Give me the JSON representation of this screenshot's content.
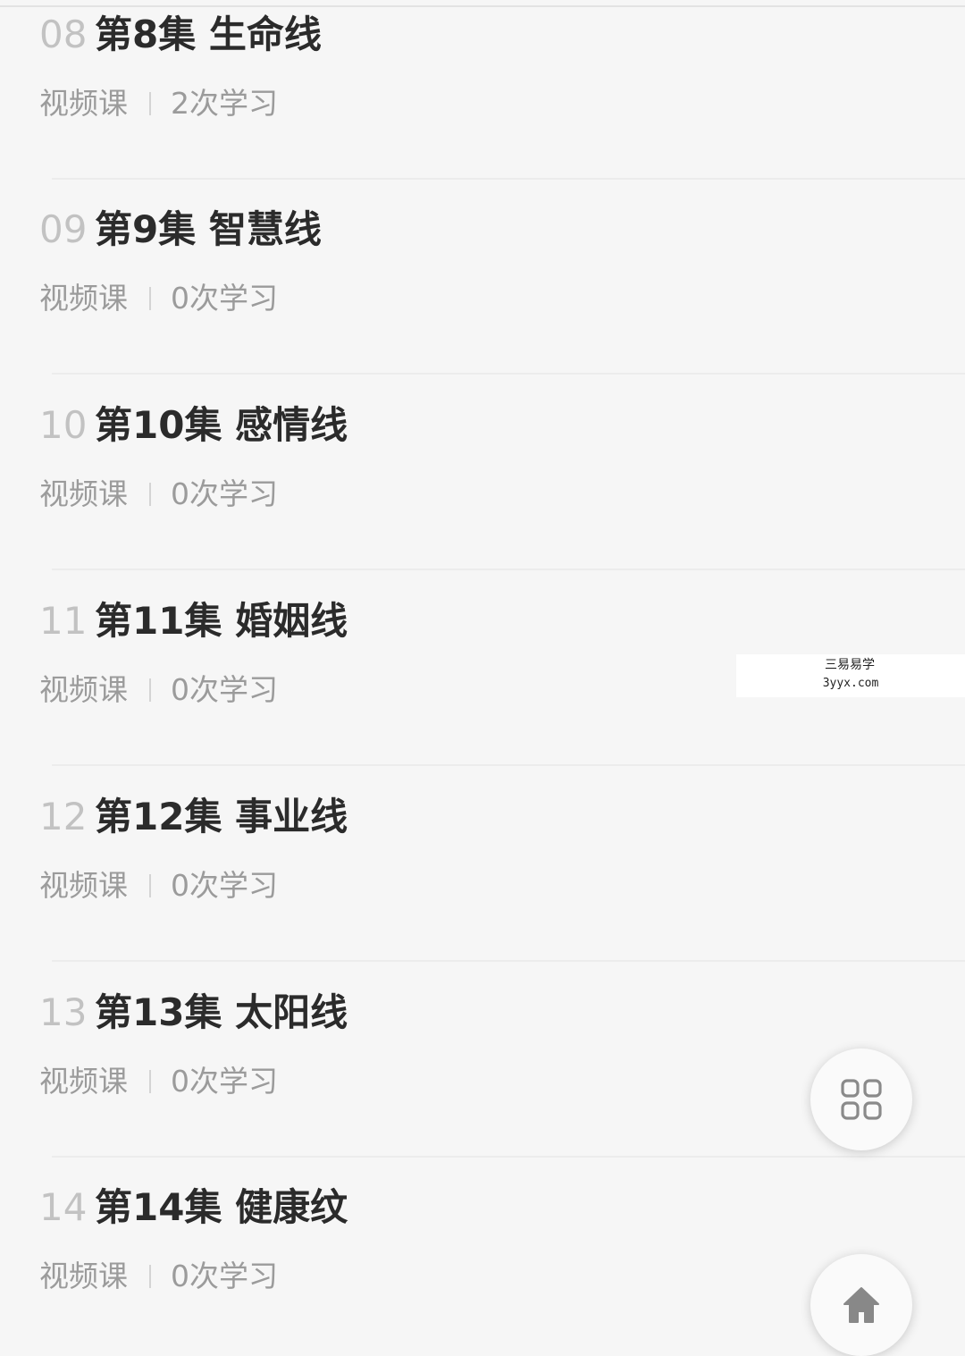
{
  "lessons": [
    {
      "num": "08",
      "title": "第8集 生命线",
      "type": "视频课",
      "study_count": "2次学习"
    },
    {
      "num": "09",
      "title": "第9集 智慧线",
      "type": "视频课",
      "study_count": "0次学习"
    },
    {
      "num": "10",
      "title": "第10集 感情线",
      "type": "视频课",
      "study_count": "0次学习"
    },
    {
      "num": "11",
      "title": "第11集 婚姻线",
      "type": "视频课",
      "study_count": "0次学习"
    },
    {
      "num": "12",
      "title": "第12集 事业线",
      "type": "视频课",
      "study_count": "0次学习"
    },
    {
      "num": "13",
      "title": "第13集 太阳线",
      "type": "视频课",
      "study_count": "0次学习"
    },
    {
      "num": "14",
      "title": "第14集 健康纹",
      "type": "视频课",
      "study_count": "0次学习"
    }
  ],
  "watermark": {
    "name": "三易易学",
    "url": "3yyx.com"
  },
  "fab": {
    "menu_icon": "grid-icon",
    "home_icon": "home-icon"
  },
  "colors": {
    "background": "#f6f6f6",
    "title": "#2b2b2b",
    "number": "#c2c2c2",
    "meta": "#9b9b9b"
  }
}
